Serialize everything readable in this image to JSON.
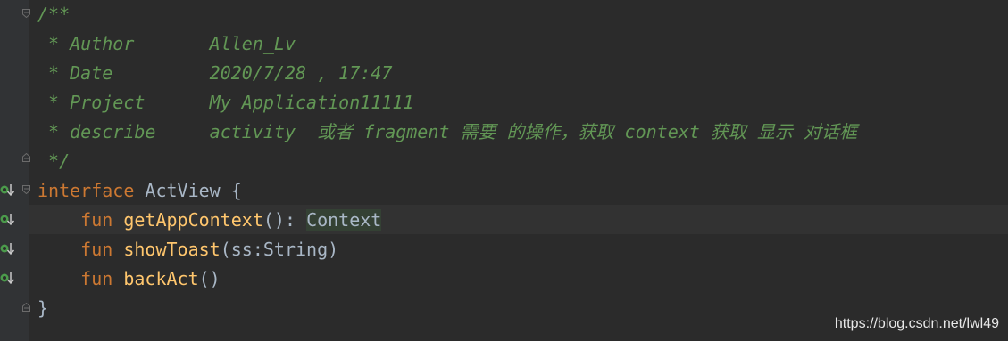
{
  "doc_comment": {
    "open": "/**",
    "author_key": " * Author       ",
    "author_val": "Allen_Lv",
    "date_key": " * Date         ",
    "date_val": "2020/7/28 , 17:47",
    "project_key": " * Project      ",
    "project_val": "My Application11111",
    "describe_key": " * describe     ",
    "describe_val": "activity  或者 fragment 需要 的操作，获取 context 获取 显示 对话框",
    "close": " */"
  },
  "code": {
    "interface_kw": "interface",
    "interface_name": " ActView {",
    "fun_kw": "fun",
    "fn1_name": "getAppContext",
    "fn1_params": "(): ",
    "fn1_return": "Context",
    "fn2_name": "showToast",
    "fn2_params": "(ss:String)",
    "fn3_name": "backAct",
    "fn3_params": "()",
    "close_brace": "}"
  },
  "watermark": "https://blog.csdn.net/lwl49",
  "colors": {
    "background": "#2b2b2b",
    "doc_comment": "#629755",
    "keyword": "#cc7832",
    "function": "#ffc66d",
    "plain": "#a9b7c6"
  }
}
